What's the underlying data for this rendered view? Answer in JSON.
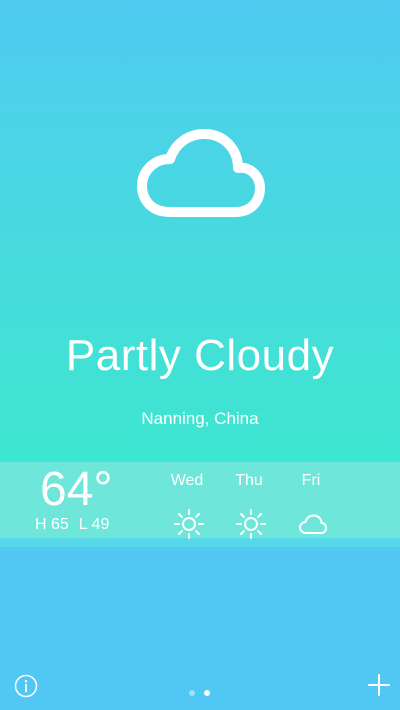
{
  "current": {
    "condition": "Partly Cloudy",
    "condition_icon": "cloud-icon",
    "location": "Nanning, China",
    "temperature": "64°",
    "high_label": "H 65",
    "low_label": "L 49"
  },
  "forecast": [
    {
      "day": "Wed",
      "icon": "sun-icon"
    },
    {
      "day": "Thu",
      "icon": "sun-icon"
    },
    {
      "day": "Fri",
      "icon": "cloud-icon"
    }
  ],
  "controls": {
    "info_icon": "info-icon",
    "add_icon": "plus-icon"
  },
  "pagination": {
    "total": 2,
    "active": 2
  },
  "colors": {
    "top_gradient_start": "#4fcbf1",
    "top_gradient_end": "#3de6cf",
    "forecast_band": "#6ee7da",
    "bottom_background": "#50c8f3",
    "text": "#ffffff"
  }
}
